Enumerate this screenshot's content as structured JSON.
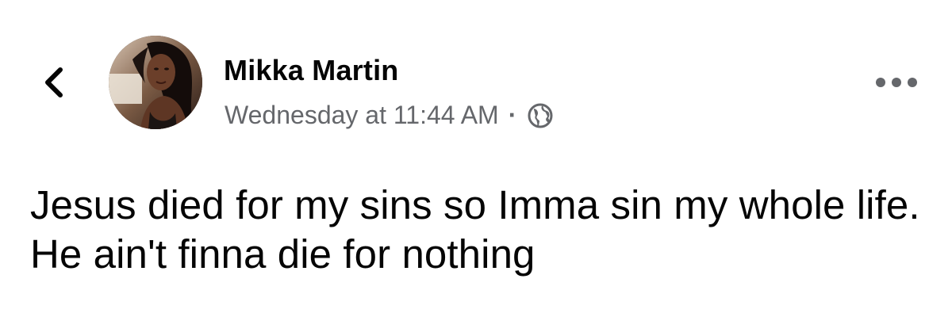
{
  "header": {
    "back_icon": "chevron-left-icon",
    "avatar_icon": "profile-photo",
    "author_name": "Mikka Martin",
    "timestamp": "Wednesday at 11:44 AM",
    "separator": "·",
    "privacy_icon": "globe-icon",
    "more_icon": "more-horizontal-icon"
  },
  "post": {
    "text": "Jesus died for my sins so Imma sin my whole life. He ain't finna die for nothing"
  },
  "colors": {
    "primary_text": "#050505",
    "secondary_text": "#65676b",
    "background": "#ffffff"
  }
}
